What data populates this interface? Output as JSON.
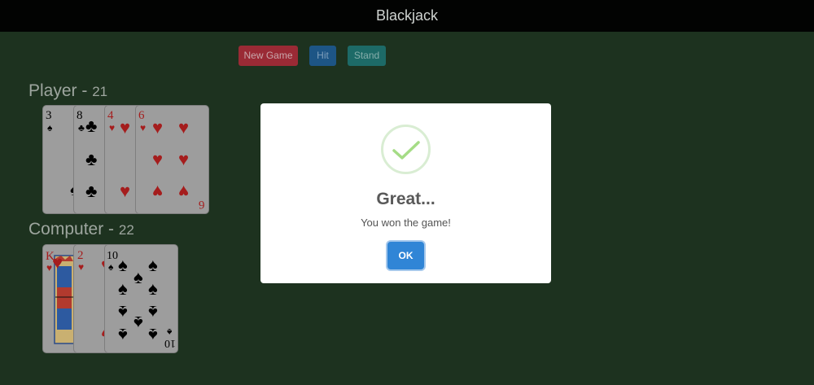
{
  "app": {
    "title": "Blackjack"
  },
  "controls": {
    "new_game": "New Game",
    "hit": "Hit",
    "stand": "Stand"
  },
  "player": {
    "label": "Player - ",
    "score": "21",
    "cards": [
      {
        "rank": "3",
        "suit": "♠",
        "color": "black"
      },
      {
        "rank": "8",
        "suit": "♣",
        "color": "black"
      },
      {
        "rank": "4",
        "suit": "♥",
        "color": "red"
      },
      {
        "rank": "6",
        "suit": "♥",
        "color": "red"
      }
    ]
  },
  "computer": {
    "label": "Computer - ",
    "score": "22",
    "cards": [
      {
        "rank": "K",
        "suit": "♥",
        "color": "red"
      },
      {
        "rank": "2",
        "suit": "♥",
        "color": "red"
      },
      {
        "rank": "10",
        "suit": "♠",
        "color": "black"
      }
    ]
  },
  "dialog": {
    "title": "Great...",
    "message": "You won the game!",
    "ok": "OK",
    "icon": "checkmark-icon",
    "icon_color": "#a5dc86"
  },
  "colors": {
    "felt": "#1d321f",
    "header": "#020302",
    "new_game": "#9a2a35",
    "hit": "#1d5585",
    "stand": "#1d6a67",
    "ok": "#3085d6"
  }
}
